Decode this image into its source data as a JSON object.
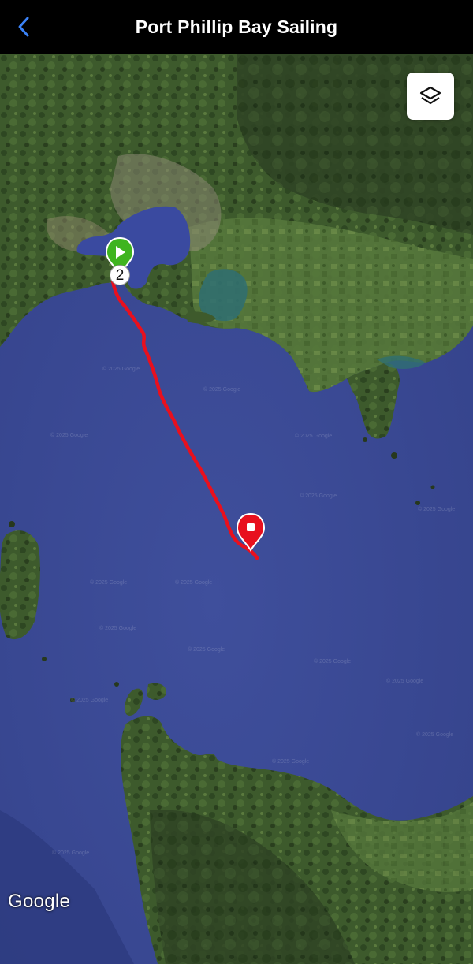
{
  "header": {
    "title": "Port Phillip Bay Sailing",
    "back_icon": "chevron-left-icon"
  },
  "map": {
    "map_type": "satellite",
    "layers_icon": "layers-icon",
    "attribution": "Google",
    "watermark": "© 2025 Google",
    "start_marker": {
      "icon": "play-icon",
      "color": "#3fb41f"
    },
    "end_marker": {
      "icon": "stop-icon",
      "color": "#e8101e"
    },
    "cluster_count": "2",
    "track_color": "#e8101e"
  }
}
